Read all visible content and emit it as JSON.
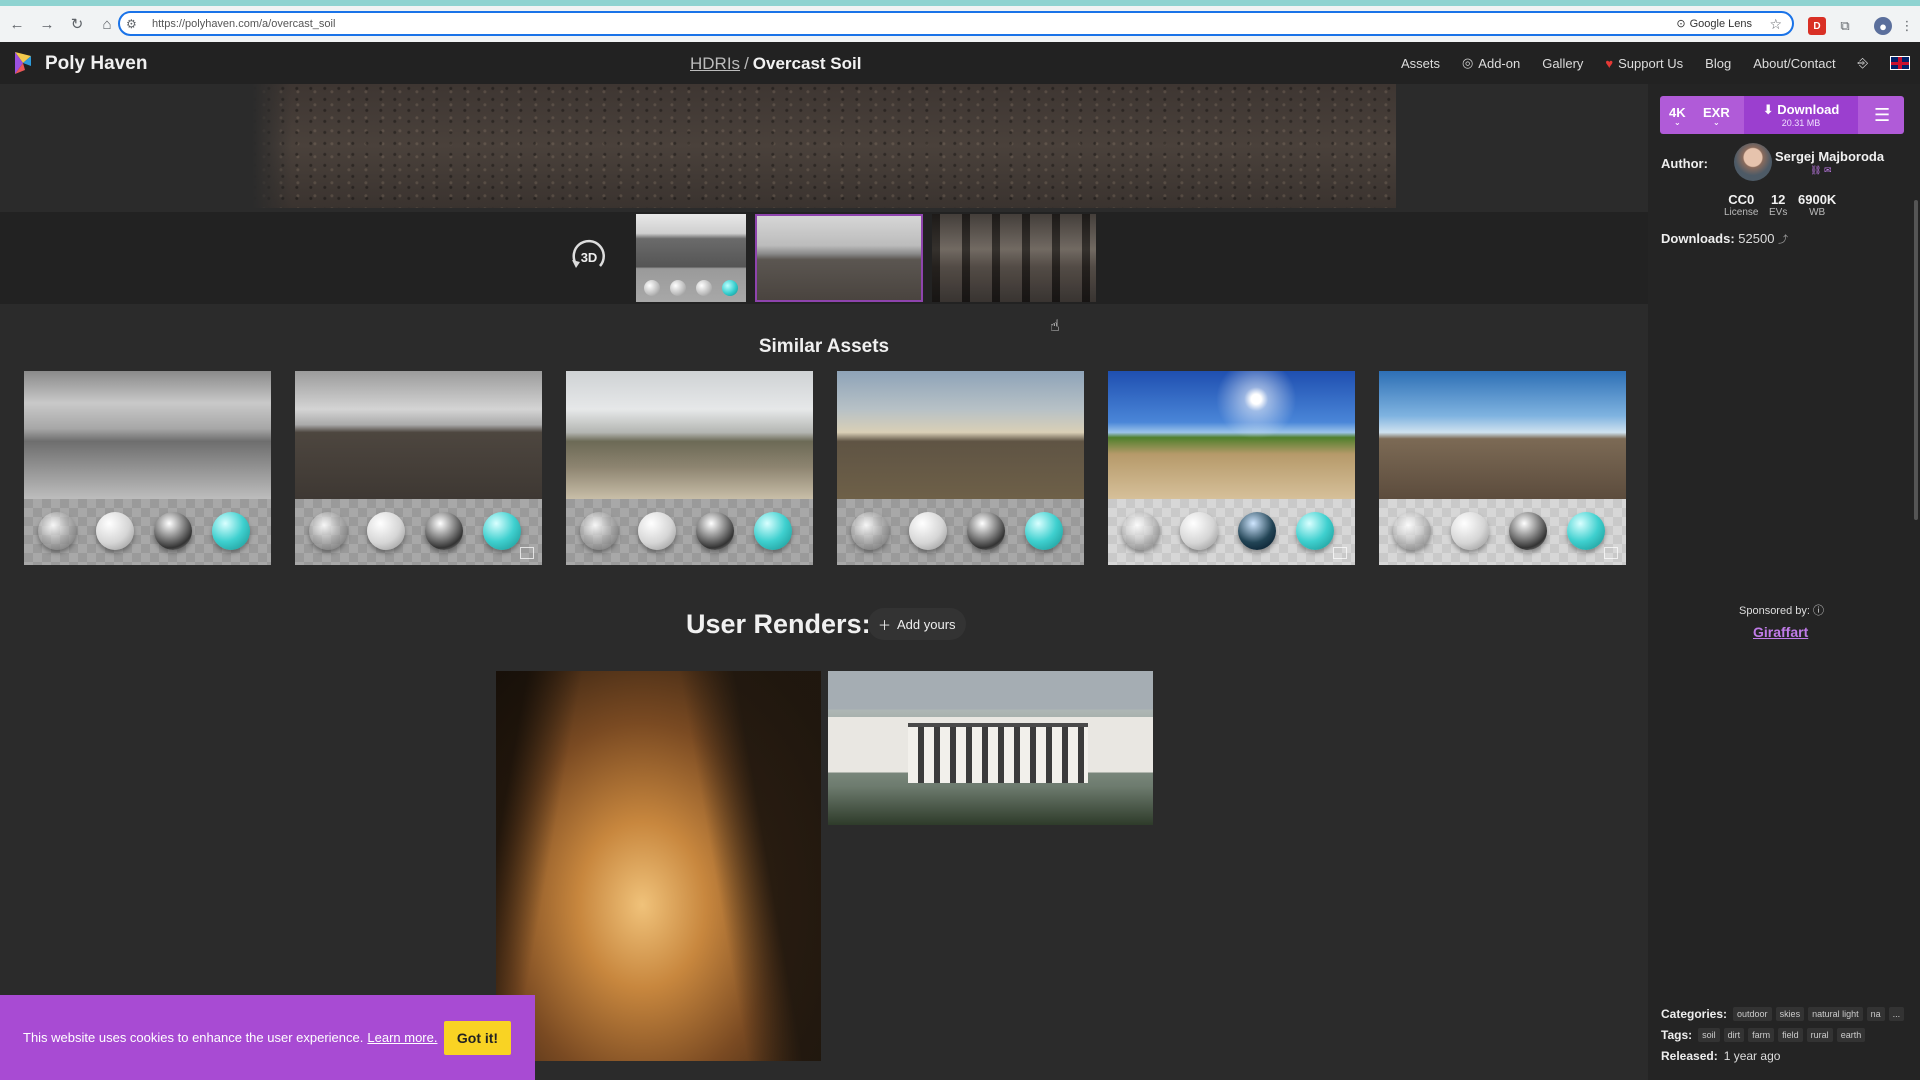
{
  "browser": {
    "url": "https://polyhaven.com/a/overcast_soil",
    "lens_label": "Google Lens"
  },
  "header": {
    "brand": "Poly Haven",
    "breadcrumb_parent": "HDRIs",
    "breadcrumb_sep": "/",
    "breadcrumb_title": "Overcast Soil",
    "nav": {
      "assets": "Assets",
      "addon": "Add-on",
      "gallery": "Gallery",
      "support": "Support Us",
      "blog": "Blog",
      "about": "About/Contact"
    }
  },
  "viewer": {
    "label_3d": "3D"
  },
  "similar": {
    "title": "Similar Assets"
  },
  "renders": {
    "title": "User Renders:",
    "add_label": "Add yours"
  },
  "cookie": {
    "text": "This website uses cookies to enhance the user experience.",
    "link": "Learn more.",
    "button": "Got it!"
  },
  "sidebar": {
    "resolution": "4K",
    "format": "EXR",
    "download_label": "Download",
    "download_size": "20.31 MB",
    "author_label": "Author:",
    "author_name": "Sergej Majboroda",
    "license_value": "CC0",
    "license_label": "License",
    "evs_value": "12",
    "evs_label": "EVs",
    "wb_value": "6900K",
    "wb_label": "WB",
    "downloads_label": "Downloads:",
    "downloads_value": "52500",
    "sponsored_label": "Sponsored by:",
    "sponsor": "Giraffart",
    "categories_label": "Categories:",
    "categories": [
      "outdoor",
      "skies",
      "natural light",
      "na",
      "..."
    ],
    "tags_label": "Tags:",
    "tags": [
      "soil",
      "dirt",
      "farm",
      "field",
      "rural",
      "earth"
    ],
    "released_label": "Released:",
    "released_value": "1 year ago"
  },
  "accent_color": "#b05bd8",
  "cookie_color": "#a84bd3",
  "button_color": "#f9d323"
}
